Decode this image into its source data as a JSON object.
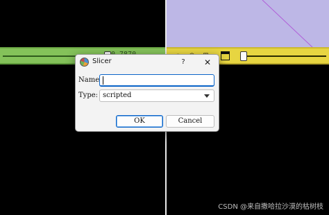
{
  "dialog": {
    "title": "Slicer",
    "help_label": "?",
    "close_label": "✕",
    "name_label": "Name:",
    "name_value": "",
    "type_label": "Type:",
    "type_value": "scripted",
    "ok_label": "OK",
    "cancel_label": "Cancel"
  },
  "background": {
    "green_slider_value": "0.7870",
    "watermark": "CSDN @来自撒哈拉沙漠的枯树枝",
    "colors": {
      "view_3d": "#bdb7e6",
      "green_bar": "#84c25a",
      "yellow_bar": "#e7d541",
      "accent": "#0a64c8"
    }
  },
  "icons": [
    "slicer-app-icon",
    "link-icon",
    "eye-icon",
    "pin-icon",
    "layout-icon",
    "help-icon",
    "close-icon",
    "chevron-down-icon"
  ]
}
